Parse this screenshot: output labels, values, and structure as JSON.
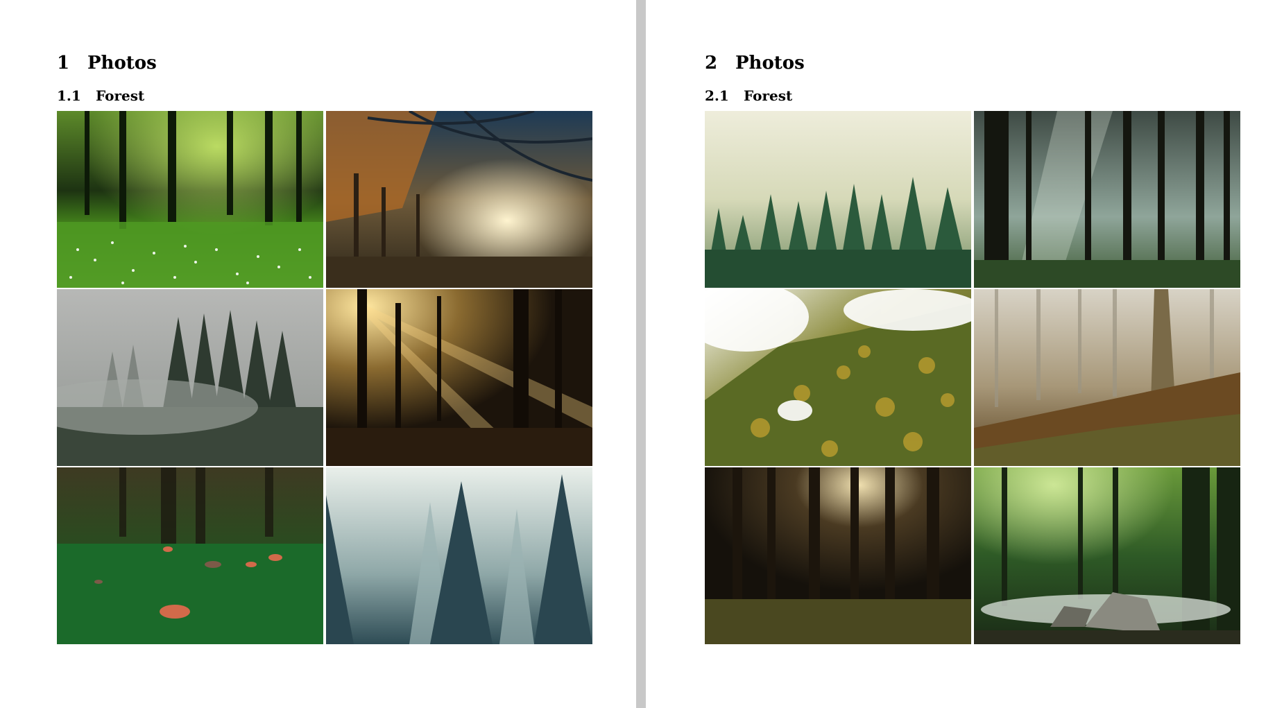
{
  "pages": [
    {
      "section_number": "1",
      "section_title": "Photos",
      "subsection_number": "1.1",
      "subsection_title": "Forest",
      "photos": [
        {
          "subject": "sunlit green forest with daisy meadow"
        },
        {
          "subject": "autumn tree canopy tunnel with sun rays"
        },
        {
          "subject": "misty pine forest hillside"
        },
        {
          "subject": "backlit forest path with sunbeams"
        },
        {
          "subject": "mossy forest floor with red mushrooms"
        },
        {
          "subject": "foggy blue fir forest"
        }
      ]
    },
    {
      "section_number": "2",
      "section_title": "Photos",
      "subsection_number": "2.1",
      "subsection_title": "Forest",
      "photos": [
        {
          "subject": "green pine treetops in pale fog"
        },
        {
          "subject": "dark forest with light shafts"
        },
        {
          "subject": "aerial forest with drifting clouds"
        },
        {
          "subject": "misty autumn woodland with grass"
        },
        {
          "subject": "dark pine forest with low sun"
        },
        {
          "subject": "green forest with mist over rocks"
        }
      ]
    }
  ]
}
